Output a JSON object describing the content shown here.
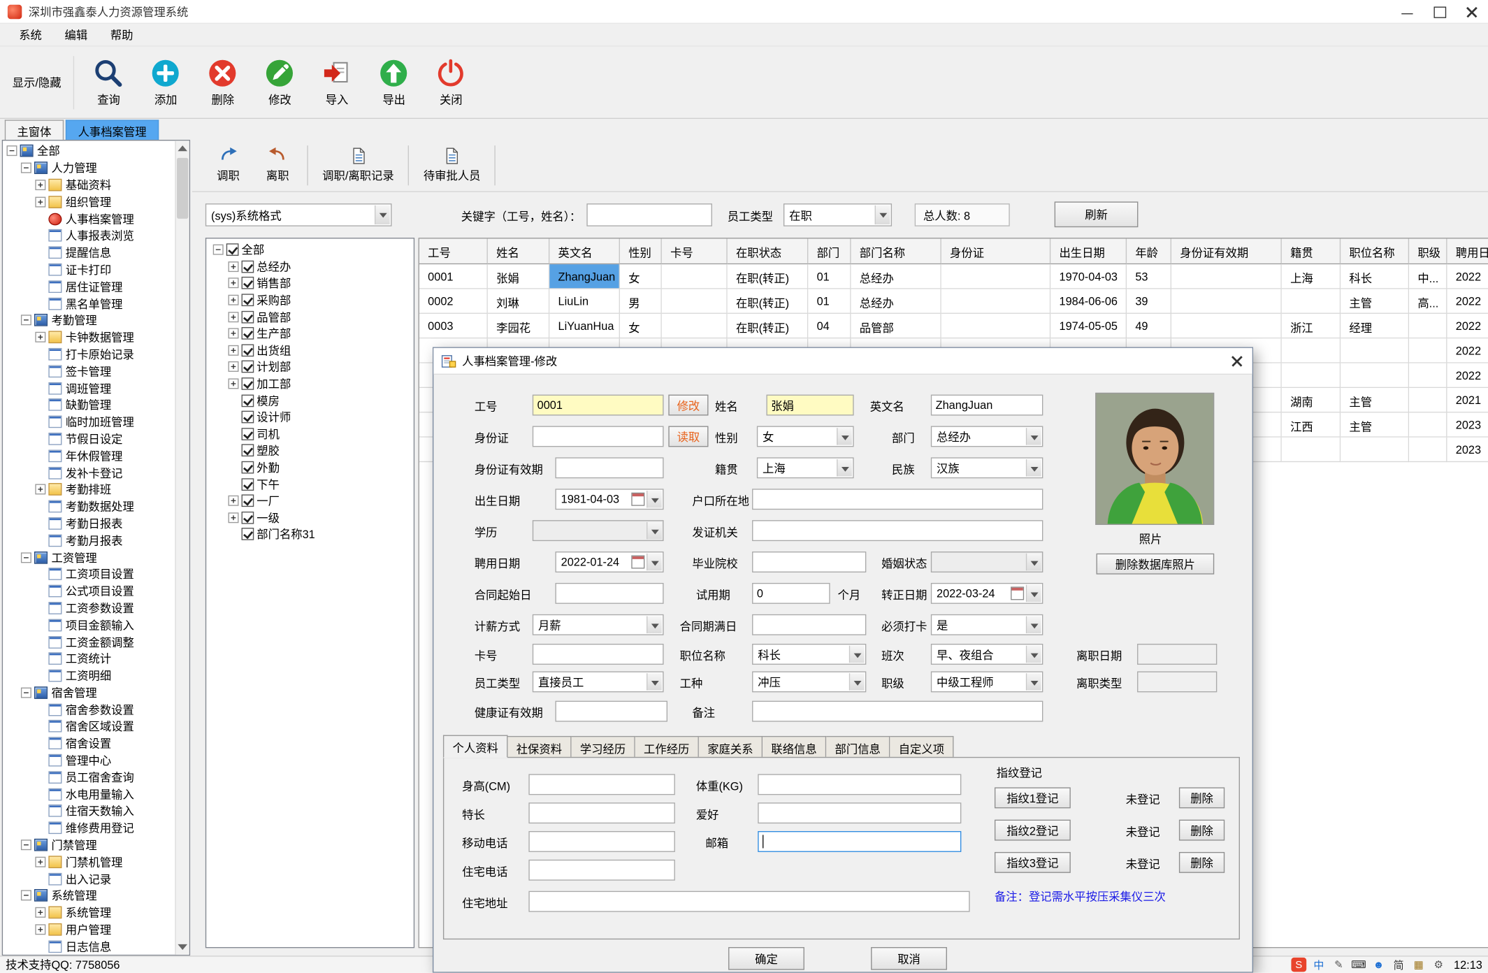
{
  "window": {
    "title": "深圳市强鑫泰人力资源管理系统"
  },
  "menus": [
    "系统",
    "编辑",
    "帮助"
  ],
  "toolbar": {
    "toggle": "显示/隐藏",
    "buttons": [
      {
        "label": "查询",
        "icon": "search"
      },
      {
        "label": "添加",
        "icon": "add"
      },
      {
        "label": "删除",
        "icon": "del"
      },
      {
        "label": "修改",
        "icon": "edit"
      },
      {
        "label": "导入",
        "icon": "imp"
      },
      {
        "label": "导出",
        "icon": "exp"
      },
      {
        "label": "关闭",
        "icon": "power"
      }
    ]
  },
  "tabs": [
    {
      "label": "主窗体",
      "active": false
    },
    {
      "label": "人事档案管理",
      "active": true
    }
  ],
  "nav_tree": [
    {
      "level": 0,
      "label": "全部",
      "exp": "minus",
      "icon": "org"
    },
    {
      "level": 1,
      "label": "人力管理",
      "exp": "minus",
      "icon": "org"
    },
    {
      "level": 2,
      "label": "基础资料",
      "exp": "plus",
      "icon": "folder"
    },
    {
      "level": 2,
      "label": "组织管理",
      "exp": "plus",
      "icon": "folder"
    },
    {
      "level": 2,
      "label": "人事档案管理",
      "exp": null,
      "icon": "dot"
    },
    {
      "level": 2,
      "label": "人事报表浏览",
      "exp": null,
      "icon": "page"
    },
    {
      "level": 2,
      "label": "提醒信息",
      "exp": null,
      "icon": "page"
    },
    {
      "level": 2,
      "label": "证卡打印",
      "exp": null,
      "icon": "page"
    },
    {
      "level": 2,
      "label": "居住证管理",
      "exp": null,
      "icon": "page"
    },
    {
      "level": 2,
      "label": "黑名单管理",
      "exp": null,
      "icon": "page"
    },
    {
      "level": 1,
      "label": "考勤管理",
      "exp": "minus",
      "icon": "org"
    },
    {
      "level": 2,
      "label": "卡钟数据管理",
      "exp": "plus",
      "icon": "folder"
    },
    {
      "level": 2,
      "label": "打卡原始记录",
      "exp": null,
      "icon": "page"
    },
    {
      "level": 2,
      "label": "签卡管理",
      "exp": null,
      "icon": "page"
    },
    {
      "level": 2,
      "label": "调班管理",
      "exp": null,
      "icon": "page"
    },
    {
      "level": 2,
      "label": "缺勤管理",
      "exp": null,
      "icon": "page"
    },
    {
      "level": 2,
      "label": "临时加班管理",
      "exp": null,
      "icon": "page"
    },
    {
      "level": 2,
      "label": "节假日设定",
      "exp": null,
      "icon": "page"
    },
    {
      "level": 2,
      "label": "年休假管理",
      "exp": null,
      "icon": "page"
    },
    {
      "level": 2,
      "label": "发补卡登记",
      "exp": null,
      "icon": "page"
    },
    {
      "level": 2,
      "label": "考勤排班",
      "exp": "plus",
      "icon": "folder"
    },
    {
      "level": 2,
      "label": "考勤数据处理",
      "exp": null,
      "icon": "page"
    },
    {
      "level": 2,
      "label": "考勤日报表",
      "exp": null,
      "icon": "page"
    },
    {
      "level": 2,
      "label": "考勤月报表",
      "exp": null,
      "icon": "page"
    },
    {
      "level": 1,
      "label": "工资管理",
      "exp": "minus",
      "icon": "org"
    },
    {
      "level": 2,
      "label": "工资项目设置",
      "exp": null,
      "icon": "page"
    },
    {
      "level": 2,
      "label": "公式项目设置",
      "exp": null,
      "icon": "page"
    },
    {
      "level": 2,
      "label": "工资参数设置",
      "exp": null,
      "icon": "page"
    },
    {
      "level": 2,
      "label": "项目金额输入",
      "exp": null,
      "icon": "page"
    },
    {
      "level": 2,
      "label": "工资金额调整",
      "exp": null,
      "icon": "page"
    },
    {
      "level": 2,
      "label": "工资统计",
      "exp": null,
      "icon": "page"
    },
    {
      "level": 2,
      "label": "工资明细",
      "exp": null,
      "icon": "page"
    },
    {
      "level": 1,
      "label": "宿舍管理",
      "exp": "minus",
      "icon": "org"
    },
    {
      "level": 2,
      "label": "宿舍参数设置",
      "exp": null,
      "icon": "page"
    },
    {
      "level": 2,
      "label": "宿舍区域设置",
      "exp": null,
      "icon": "page"
    },
    {
      "level": 2,
      "label": "宿舍设置",
      "exp": null,
      "icon": "page"
    },
    {
      "level": 2,
      "label": "管理中心",
      "exp": null,
      "icon": "page"
    },
    {
      "level": 2,
      "label": "员工宿舍查询",
      "exp": null,
      "icon": "page"
    },
    {
      "level": 2,
      "label": "水电用量输入",
      "exp": null,
      "icon": "page"
    },
    {
      "level": 2,
      "label": "住宿天数输入",
      "exp": null,
      "icon": "page"
    },
    {
      "level": 2,
      "label": "维修费用登记",
      "exp": null,
      "icon": "page"
    },
    {
      "level": 1,
      "label": "门禁管理",
      "exp": "minus",
      "icon": "org"
    },
    {
      "level": 2,
      "label": "门禁机管理",
      "exp": "plus",
      "icon": "folder"
    },
    {
      "level": 2,
      "label": "出入记录",
      "exp": null,
      "icon": "page"
    },
    {
      "level": 1,
      "label": "系统管理",
      "exp": "minus",
      "icon": "org"
    },
    {
      "level": 2,
      "label": "系统管理",
      "exp": "plus",
      "icon": "folder"
    },
    {
      "level": 2,
      "label": "用户管理",
      "exp": "plus",
      "icon": "folder"
    },
    {
      "level": 2,
      "label": "日志信息",
      "exp": null,
      "icon": "page"
    }
  ],
  "subtoolbar": [
    {
      "label": "调职",
      "icon": "tin"
    },
    {
      "label": "离职",
      "icon": "tout"
    },
    {
      "label": "调职/离职记录",
      "icon": "doc"
    },
    {
      "label": "待审批人员",
      "icon": "doc"
    }
  ],
  "filter": {
    "format": "(sys)系统格式",
    "keyword_label": "关键字（工号，姓名）：",
    "keyword_value": "",
    "type_label": "员工类型",
    "type_value": "在职",
    "total": "总人数: 8",
    "refresh": "刷新"
  },
  "dept_tree": [
    {
      "level": 0,
      "label": "全部",
      "exp": "minus"
    },
    {
      "level": 1,
      "label": "总经办",
      "exp": "plus"
    },
    {
      "level": 1,
      "label": "销售部",
      "exp": "plus"
    },
    {
      "level": 1,
      "label": "采购部",
      "exp": "plus"
    },
    {
      "level": 1,
      "label": "品管部",
      "exp": "plus"
    },
    {
      "level": 1,
      "label": "生产部",
      "exp": "plus"
    },
    {
      "level": 1,
      "label": "出货组",
      "exp": "plus"
    },
    {
      "level": 1,
      "label": "计划部",
      "exp": "plus"
    },
    {
      "level": 1,
      "label": "加工部",
      "exp": "plus"
    },
    {
      "level": 1,
      "label": "模房",
      "exp": null
    },
    {
      "level": 1,
      "label": "设计师",
      "exp": null
    },
    {
      "level": 1,
      "label": "司机",
      "exp": null
    },
    {
      "level": 1,
      "label": "塑胶",
      "exp": null
    },
    {
      "level": 1,
      "label": "外勤",
      "exp": null
    },
    {
      "level": 1,
      "label": "下午",
      "exp": null
    },
    {
      "level": 1,
      "label": "一厂",
      "exp": "plus"
    },
    {
      "level": 1,
      "label": "一级",
      "exp": "plus"
    },
    {
      "level": 1,
      "label": "部门名称31",
      "exp": null
    }
  ],
  "table": {
    "columns": [
      "工号",
      "姓名",
      "英文名",
      "性别",
      "卡号",
      "在职状态",
      "部门",
      "部门名称",
      "身份证",
      "出生日期",
      "年龄",
      "身份证有效期",
      "籍贯",
      "职位名称",
      "职级",
      "聘用日期"
    ],
    "rows": [
      [
        "0001",
        "张娟",
        "ZhangJuan",
        "女",
        "",
        "在职(转正)",
        "01",
        "总经办",
        "",
        "1970-04-03",
        "53",
        "",
        "上海",
        "科长",
        "中...",
        "2022"
      ],
      [
        "0002",
        "刘琳",
        "LiuLin",
        "男",
        "",
        "在职(转正)",
        "01",
        "总经办",
        "",
        "1984-06-06",
        "39",
        "",
        "",
        "主管",
        "高...",
        "2022"
      ],
      [
        "0003",
        "李园花",
        "LiYuanHua",
        "女",
        "",
        "在职(转正)",
        "04",
        "品管部",
        "",
        "1974-05-05",
        "49",
        "",
        "浙江",
        "经理",
        "",
        "2022"
      ],
      [
        "",
        "",
        "",
        "",
        "",
        "",
        "",
        "",
        "",
        "",
        "",
        "",
        "",
        "",
        "",
        "2022"
      ],
      [
        "",
        "",
        "",
        "",
        "",
        "",
        "",
        "",
        "",
        "",
        "",
        "",
        "",
        "",
        "",
        "2022"
      ],
      [
        "",
        "",
        "",
        "",
        "",
        "",
        "",
        "",
        "",
        "",
        "",
        "",
        "湖南",
        "主管",
        "",
        "2021"
      ],
      [
        "",
        "",
        "",
        "",
        "",
        "",
        "",
        "",
        "",
        "",
        "",
        "",
        "江西",
        "主管",
        "",
        "2023"
      ],
      [
        "",
        "",
        "",
        "",
        "",
        "",
        "",
        "",
        "",
        "",
        "",
        "",
        "",
        "",
        "",
        "2023"
      ]
    ],
    "selected_cell": {
      "row": 0,
      "col": 2
    }
  },
  "dialog": {
    "title": "人事档案管理-修改",
    "modify_btn": "修改",
    "read_btn": "读取",
    "fields": {
      "emp_no": {
        "label": "工号",
        "value": "0001"
      },
      "name": {
        "label": "姓名",
        "value": "张娟"
      },
      "en_name": {
        "label": "英文名",
        "value": "ZhangJuan"
      },
      "id_card": {
        "label": "身份证",
        "value": ""
      },
      "gender": {
        "label": "性别",
        "value": "女"
      },
      "dept": {
        "label": "部门",
        "value": "总经办"
      },
      "id_valid": {
        "label": "身份证有效期",
        "value": ""
      },
      "native": {
        "label": "籍贯",
        "value": "上海"
      },
      "ethnic": {
        "label": "民族",
        "value": "汉族"
      },
      "birth": {
        "label": "出生日期",
        "value": "1981-04-03"
      },
      "household": {
        "label": "户口所在地",
        "value": ""
      },
      "education": {
        "label": "学历",
        "value": ""
      },
      "issuer": {
        "label": "发证机关",
        "value": ""
      },
      "hire_date": {
        "label": "聘用日期",
        "value": "2022-01-24"
      },
      "school": {
        "label": "毕业院校",
        "value": ""
      },
      "marital": {
        "label": "婚姻状态",
        "value": ""
      },
      "contract_start": {
        "label": "合同起始日",
        "value": ""
      },
      "probation": {
        "label": "试用期",
        "value": "0",
        "suffix": "个月"
      },
      "regular_date": {
        "label": "转正日期",
        "value": "2022-03-24"
      },
      "pay_type": {
        "label": "计薪方式",
        "value": "月薪"
      },
      "contract_end": {
        "label": "合同期满日",
        "value": ""
      },
      "must_punch": {
        "label": "必须打卡",
        "value": "是"
      },
      "card_no": {
        "label": "卡号",
        "value": ""
      },
      "position": {
        "label": "职位名称",
        "value": "科长"
      },
      "shift": {
        "label": "班次",
        "value": "早、夜组合"
      },
      "leave_date": {
        "label": "离职日期",
        "value": ""
      },
      "emp_type": {
        "label": "员工类型",
        "value": "直接员工"
      },
      "work_type": {
        "label": "工种",
        "value": "冲压"
      },
      "rank": {
        "label": "职级",
        "value": "中级工程师"
      },
      "leave_type": {
        "label": "离职类型",
        "value": ""
      },
      "health_valid": {
        "label": "健康证有效期",
        "value": ""
      },
      "remark": {
        "label": "备注",
        "value": ""
      }
    },
    "photo_label": "照片",
    "delete_photo_btn": "删除数据库照片",
    "tabs": [
      "个人资料",
      "社保资料",
      "学习经历",
      "工作经历",
      "家庭关系",
      "联络信息",
      "部门信息",
      "自定义项"
    ],
    "active_tab": "个人资料",
    "personal": {
      "height": {
        "label": "身高(CM)",
        "value": ""
      },
      "weight": {
        "label": "体重(KG)",
        "value": ""
      },
      "specialty": {
        "label": "特长",
        "value": ""
      },
      "hobby": {
        "label": "爱好",
        "value": ""
      },
      "mobile": {
        "label": "移动电话",
        "value": ""
      },
      "email": {
        "label": "邮箱",
        "value": ""
      },
      "home_phone": {
        "label": "住宅电话",
        "value": ""
      },
      "home_addr": {
        "label": "住宅地址",
        "value": ""
      }
    },
    "fingerprint": {
      "title": "指纹登记",
      "rows": [
        {
          "btn": "指纹1登记",
          "status": "未登记",
          "del": "删除"
        },
        {
          "btn": "指纹2登记",
          "status": "未登记",
          "del": "删除"
        },
        {
          "btn": "指纹3登记",
          "status": "未登记",
          "del": "删除"
        }
      ],
      "note": "备注：登记需水平按压采集仪三次"
    },
    "ok_btn": "确定",
    "cancel_btn": "取消"
  },
  "statusbar": {
    "left": "技术支持QQ: 7758056",
    "time": "12:13",
    "tray": [
      {
        "name": "sogou-input-icon",
        "glyph": "S",
        "fg": "#ffffff",
        "bg": "#e8442c"
      },
      {
        "name": "lang-chinese-icon",
        "glyph": "中",
        "fg": "#1c6fd4",
        "bg": ""
      },
      {
        "name": "handwriting-icon",
        "glyph": "✎",
        "fg": "#555555",
        "bg": ""
      },
      {
        "name": "keyboard-icon",
        "glyph": "⌨",
        "fg": "#333333",
        "bg": ""
      },
      {
        "name": "user-icon",
        "glyph": "☻",
        "fg": "#1c6fd4",
        "bg": ""
      },
      {
        "name": "simplified-chinese-icon",
        "glyph": "简",
        "fg": "#333333",
        "bg": ""
      },
      {
        "name": "toolbox-icon",
        "glyph": "▦",
        "fg": "#a07820",
        "bg": ""
      },
      {
        "name": "settings-gear-icon",
        "glyph": "⚙",
        "fg": "#555555",
        "bg": ""
      }
    ]
  }
}
